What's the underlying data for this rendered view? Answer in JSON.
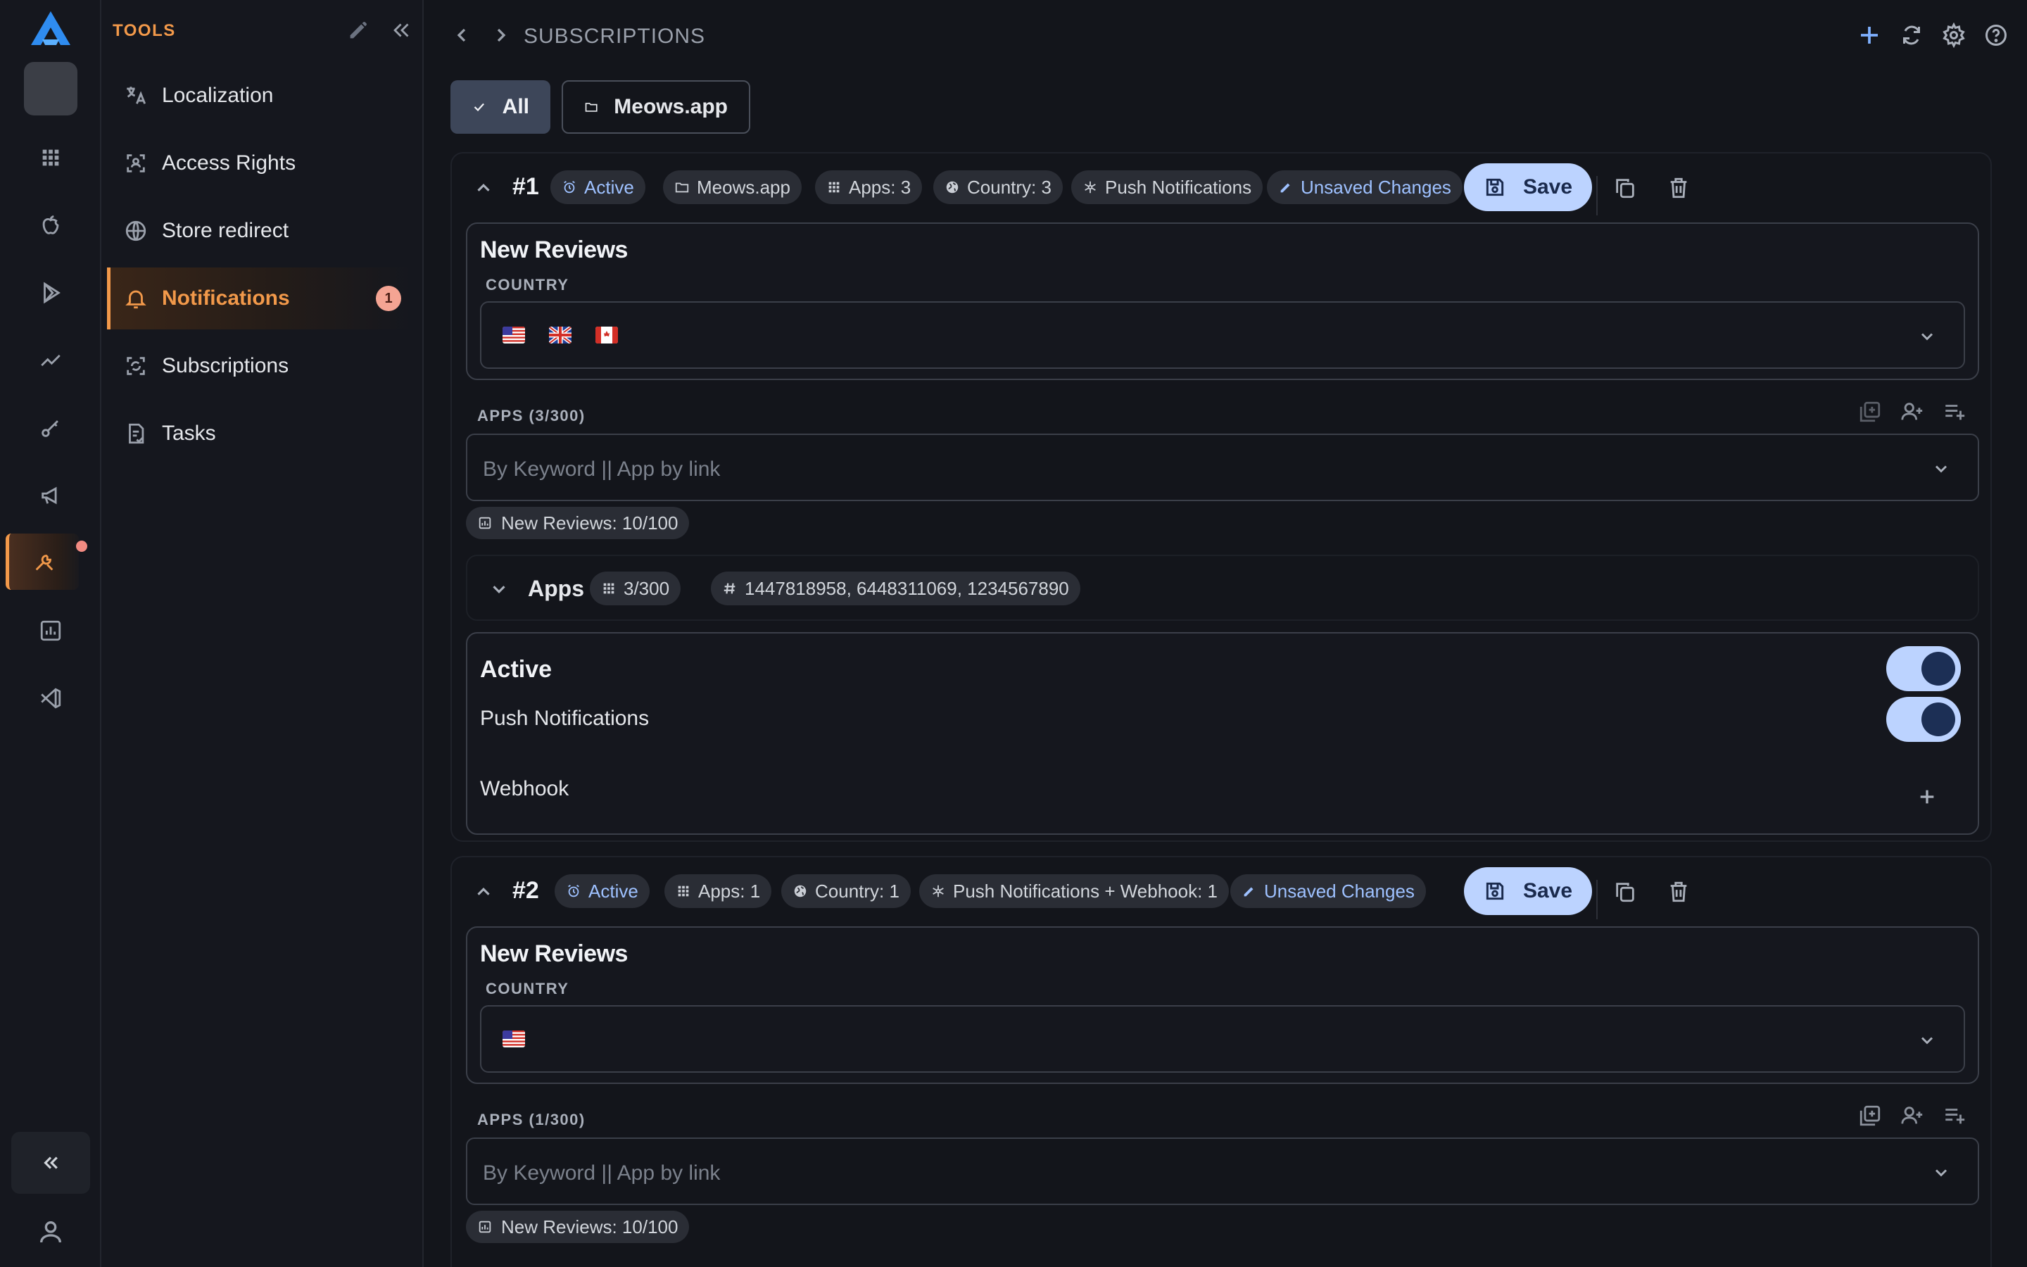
{
  "rail": {
    "items": [
      {
        "name": "rail-apps",
        "icon": "grid-icon"
      },
      {
        "name": "rail-apple",
        "icon": "apple-icon"
      },
      {
        "name": "rail-google-play",
        "icon": "play-icon"
      },
      {
        "name": "rail-analytics",
        "icon": "trend-icon"
      },
      {
        "name": "rail-keywords",
        "icon": "key-icon"
      },
      {
        "name": "rail-campaigns",
        "icon": "megaphone-icon"
      },
      {
        "name": "rail-tools",
        "icon": "tools-icon",
        "active": true
      },
      {
        "name": "rail-reports",
        "icon": "bar-chart-icon"
      },
      {
        "name": "rail-code",
        "icon": "vscode-icon"
      }
    ]
  },
  "tools": {
    "title": "TOOLS",
    "items": [
      {
        "label": "Localization",
        "icon": "translate-icon"
      },
      {
        "label": "Access Rights",
        "icon": "access-icon"
      },
      {
        "label": "Store redirect",
        "icon": "globe-icon"
      },
      {
        "label": "Notifications",
        "icon": "bell-icon",
        "active": true,
        "badge": "1"
      },
      {
        "label": "Subscriptions",
        "icon": "subscriptions-icon"
      },
      {
        "label": "Tasks",
        "icon": "tasks-icon"
      }
    ]
  },
  "header": {
    "breadcrumb": "SUBSCRIPTIONS"
  },
  "filters": {
    "all_label": "All",
    "app_label": "Meows.app"
  },
  "subscriptions": [
    {
      "number": "#1",
      "chips": {
        "status": "Active",
        "app": "Meows.app",
        "apps": "Apps: 3",
        "country": "Country: 3",
        "channel": "Push Notifications",
        "unsaved": "Unsaved Changes"
      },
      "save_label": "Save",
      "box_title": "New Reviews",
      "country_label": "COUNTRY",
      "countries": [
        "us",
        "gb",
        "ca"
      ],
      "apps_label": "APPS (3/300)",
      "apps_placeholder": "By Keyword || App by link",
      "quota": "New Reviews: 10/100",
      "apps_row": {
        "title": "Apps",
        "count": "3/300",
        "ids": "1447818958, 6448311069, 1234567890"
      },
      "settings": {
        "active_label": "Active",
        "active": true,
        "push_label": "Push Notifications",
        "push": true,
        "webhook_label": "Webhook"
      }
    },
    {
      "number": "#2",
      "chips": {
        "status": "Active",
        "apps": "Apps: 1",
        "country": "Country: 1",
        "channel": "Push Notifications + Webhook: 1",
        "unsaved": "Unsaved Changes"
      },
      "save_label": "Save",
      "box_title": "New Reviews",
      "country_label": "COUNTRY",
      "countries": [
        "us"
      ],
      "apps_label": "APPS (1/300)",
      "apps_placeholder": "By Keyword || App by link",
      "quota": "New Reviews: 10/100"
    }
  ],
  "colors": {
    "accent": "#f2994a",
    "primary": "#bcd3ff",
    "chip_blue": "#9ec1ff",
    "background": "#13151b"
  }
}
